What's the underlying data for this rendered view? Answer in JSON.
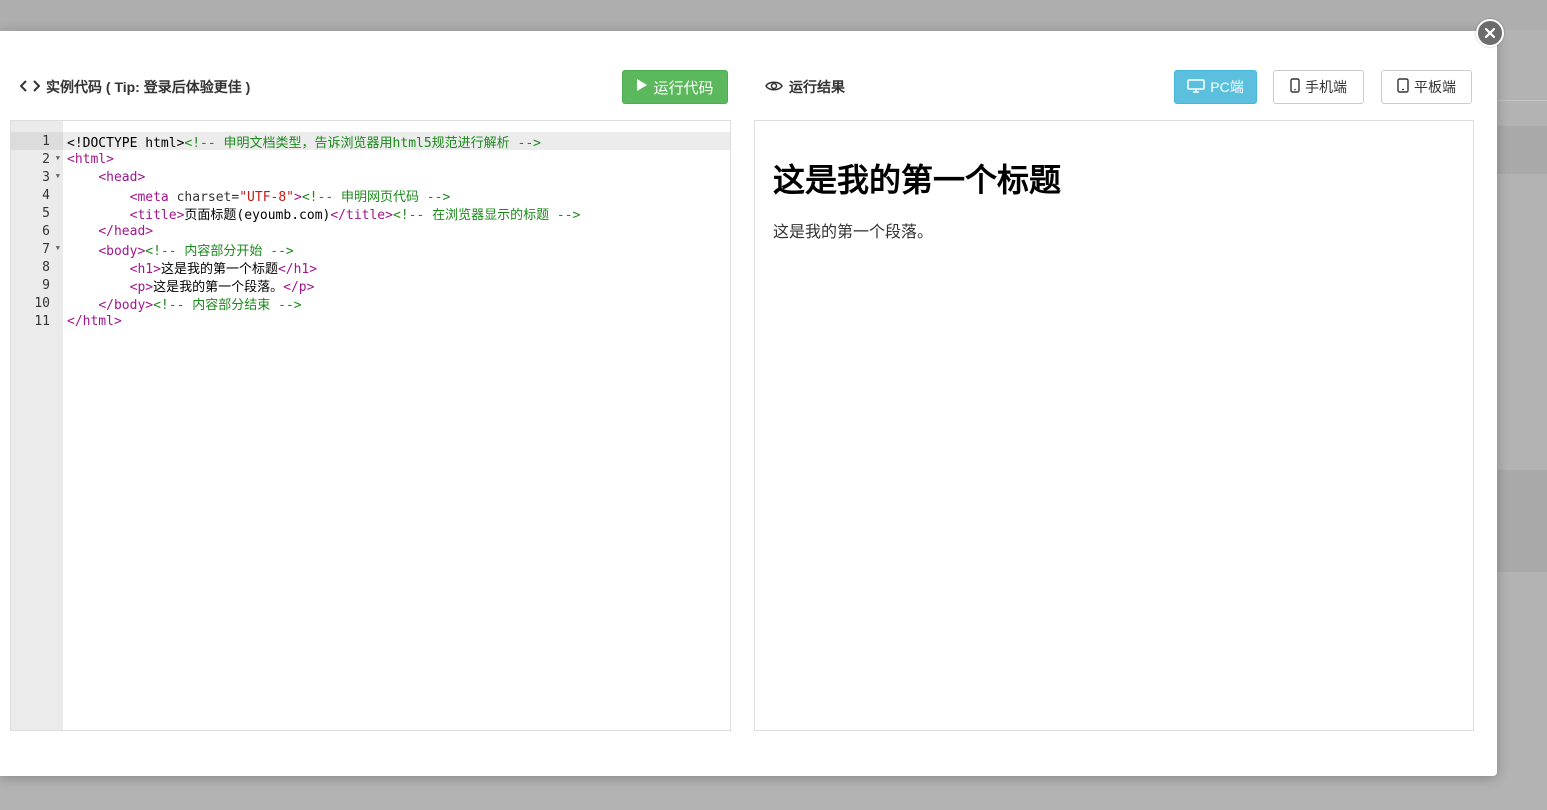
{
  "left_panel": {
    "title": "实例代码 ( Tip: 登录后体验更佳 )",
    "run_button": "运行代码"
  },
  "right_panel": {
    "title": "运行结果",
    "device_buttons": [
      {
        "label": "PC端",
        "active": true,
        "icon": "monitor-icon"
      },
      {
        "label": "手机端",
        "active": false,
        "icon": "mobile-icon"
      },
      {
        "label": "平板端",
        "active": false,
        "icon": "tablet-icon"
      }
    ]
  },
  "editor": {
    "active_line": 1,
    "lines": [
      {
        "n": "1",
        "fold": false,
        "segs": [
          [
            "x",
            "<!DOCTYPE html>"
          ],
          [
            "c",
            "<!-- 申明文档类型，告诉浏览器用html5规范进行解析 -->"
          ]
        ]
      },
      {
        "n": "2",
        "fold": true,
        "segs": [
          [
            "t",
            "<html>"
          ]
        ]
      },
      {
        "n": "3",
        "fold": true,
        "segs": [
          [
            "x",
            "    "
          ],
          [
            "t",
            "<head>"
          ]
        ]
      },
      {
        "n": "4",
        "fold": false,
        "segs": [
          [
            "x",
            "        "
          ],
          [
            "t",
            "<meta "
          ],
          [
            "a",
            "charset="
          ],
          [
            "v",
            "\"UTF-8\""
          ],
          [
            "t",
            ">"
          ],
          [
            "c",
            "<!-- 申明网页代码 -->"
          ]
        ]
      },
      {
        "n": "5",
        "fold": false,
        "segs": [
          [
            "x",
            "        "
          ],
          [
            "t",
            "<title>"
          ],
          [
            "x",
            "页面标题(eyoumb.com)"
          ],
          [
            "t",
            "</title>"
          ],
          [
            "c",
            "<!-- 在浏览器显示的标题 -->"
          ]
        ]
      },
      {
        "n": "6",
        "fold": false,
        "segs": [
          [
            "x",
            "    "
          ],
          [
            "t",
            "</head>"
          ]
        ]
      },
      {
        "n": "7",
        "fold": true,
        "segs": [
          [
            "x",
            "    "
          ],
          [
            "t",
            "<body>"
          ],
          [
            "c",
            "<!-- 内容部分开始 -->"
          ]
        ]
      },
      {
        "n": "8",
        "fold": false,
        "segs": [
          [
            "x",
            "        "
          ],
          [
            "t",
            "<h1>"
          ],
          [
            "x",
            "这是我的第一个标题"
          ],
          [
            "t",
            "</h1>"
          ]
        ]
      },
      {
        "n": "9",
        "fold": false,
        "segs": [
          [
            "x",
            "        "
          ],
          [
            "t",
            "<p>"
          ],
          [
            "x",
            "这是我的第一个段落。"
          ],
          [
            "t",
            "</p>"
          ]
        ]
      },
      {
        "n": "10",
        "fold": false,
        "segs": [
          [
            "x",
            "    "
          ],
          [
            "t",
            "</body>"
          ],
          [
            "c",
            "<!-- 内容部分结束 -->"
          ]
        ]
      },
      {
        "n": "11",
        "fold": false,
        "segs": [
          [
            "t",
            "</html>"
          ]
        ]
      }
    ]
  },
  "preview": {
    "heading": "这是我的第一个标题",
    "paragraph": "这是我的第一个段落。"
  }
}
